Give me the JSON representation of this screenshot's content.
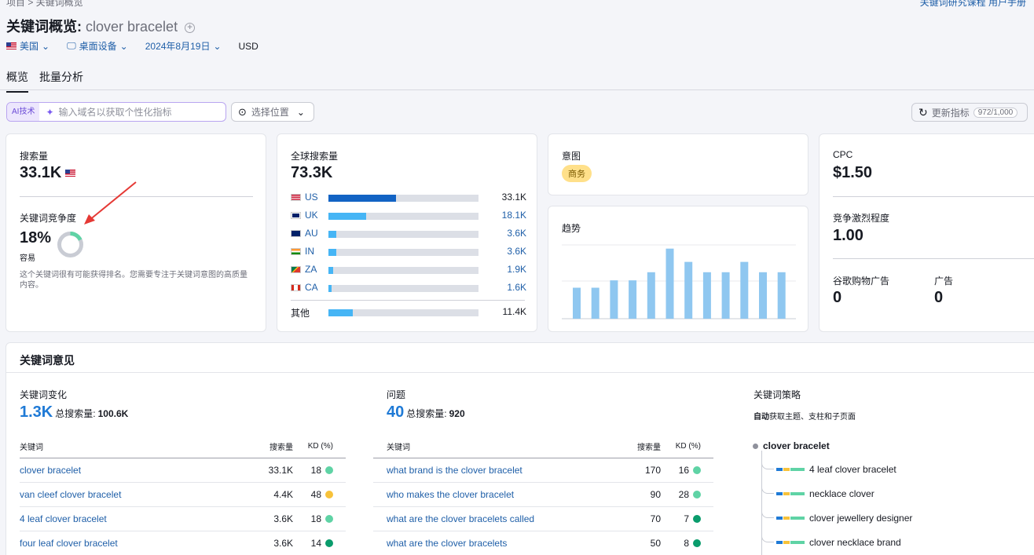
{
  "topbar": {
    "breadcrumb": "项目  >  关键词概览",
    "right_links": "关键词研究课程    用户手册"
  },
  "header": {
    "title_prefix": "关键词概览:",
    "keyword": "clover bracelet"
  },
  "filters": {
    "country": "美国",
    "device": "桌面设备",
    "date": "2024年8月19日",
    "currency": "USD"
  },
  "tabs": [
    {
      "label": "概览"
    },
    {
      "label": "批量分析"
    }
  ],
  "ai": {
    "tag": "AI技术",
    "placeholder": "输入域名以获取个性化指标"
  },
  "location": {
    "label": "选择位置"
  },
  "refresh": {
    "label": "更新指标",
    "count": "972/1,000"
  },
  "volume": {
    "label": "搜索量",
    "value": "33.1K"
  },
  "kd": {
    "label": "关键词竞争度",
    "value": "18%",
    "percent": 18,
    "level": "容易",
    "desc": "这个关键词很有可能获得排名。您需要专注于关键词意图的高质量内容。"
  },
  "global": {
    "label": "全球搜索量",
    "value": "73.3K",
    "countries": [
      {
        "code": "US",
        "value": "33.1K",
        "share": 0.45
      },
      {
        "code": "UK",
        "value": "18.1K",
        "share": 0.25
      },
      {
        "code": "AU",
        "value": "3.6K",
        "share": 0.05
      },
      {
        "code": "IN",
        "value": "3.6K",
        "share": 0.05
      },
      {
        "code": "ZA",
        "value": "1.9K",
        "share": 0.03
      },
      {
        "code": "CA",
        "value": "1.6K",
        "share": 0.02
      }
    ],
    "other": {
      "label": "其他",
      "value": "11.4K",
      "share": 0.16
    }
  },
  "intent": {
    "label": "意图",
    "badge": "商务"
  },
  "trend": {
    "label": "趋势",
    "values": [
      42,
      42,
      52,
      52,
      63,
      95,
      77,
      63,
      63,
      77,
      63,
      63
    ]
  },
  "cpc": {
    "label": "CPC",
    "value": "$1.50"
  },
  "competition": {
    "label": "竞争激烈程度",
    "value": "1.00"
  },
  "shopping": {
    "label": "谷歌购物广告",
    "value": "0"
  },
  "ads": {
    "label": "广告",
    "value": "0"
  },
  "ideas": {
    "title": "关键词意见",
    "variations": {
      "label": "关键词变化",
      "count": "1.3K",
      "total_label": "总搜索量:",
      "total": "100.6K",
      "headers": [
        "关键词",
        "搜索量",
        "KD (%)"
      ],
      "rows": [
        {
          "kw": "clover bracelet",
          "vol": "33.1K",
          "kd": "18",
          "color": "#5fd3a5"
        },
        {
          "kw": "van cleef clover bracelet",
          "vol": "4.4K",
          "kd": "48",
          "color": "#f7c23a"
        },
        {
          "kw": "4 leaf clover bracelet",
          "vol": "3.6K",
          "kd": "18",
          "color": "#5fd3a5"
        },
        {
          "kw": "four leaf clover bracelet",
          "vol": "3.6K",
          "kd": "14",
          "color": "#0a9c6c"
        }
      ]
    },
    "questions": {
      "label": "问题",
      "count": "40",
      "total_label": "总搜索量:",
      "total": "920",
      "headers": [
        "关键词",
        "搜索量",
        "KD (%)"
      ],
      "rows": [
        {
          "kw": "what brand is the clover bracelet",
          "vol": "170",
          "kd": "16",
          "color": "#5fd3a5"
        },
        {
          "kw": "who makes the clover bracelet",
          "vol": "90",
          "kd": "28",
          "color": "#5fd3a5"
        },
        {
          "kw": "what are the clover bracelets called",
          "vol": "70",
          "kd": "7",
          "color": "#0a9c6c"
        },
        {
          "kw": "what are the clover bracelets",
          "vol": "50",
          "kd": "8",
          "color": "#0a9c6c"
        }
      ]
    },
    "strategy": {
      "label": "关键词策略",
      "sub_bold": "自动",
      "sub_rest": "获取主题、支柱和子页面",
      "root": "clover bracelet",
      "children": [
        "4 leaf clover bracelet",
        "necklace clover",
        "clover jewellery designer",
        "clover necklace brand"
      ]
    }
  }
}
